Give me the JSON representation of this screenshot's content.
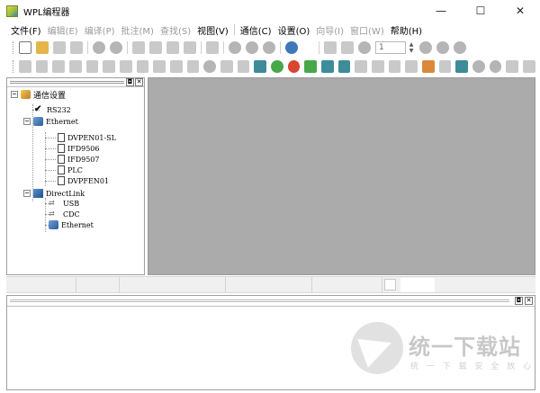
{
  "window": {
    "title": "WPL编程器",
    "minimize": "—",
    "maximize": "☐",
    "close": "✕"
  },
  "menu": [
    {
      "label": "文件(F)",
      "enabled": true
    },
    {
      "label": "编辑(E)",
      "enabled": false
    },
    {
      "label": "编译(P)",
      "enabled": false
    },
    {
      "label": "批注(M)",
      "enabled": false
    },
    {
      "label": "查找(S)",
      "enabled": false
    },
    {
      "label": "视图(V)",
      "enabled": true
    },
    {
      "label": "通信(C)",
      "enabled": true
    },
    {
      "label": "设置(O)",
      "enabled": true
    },
    {
      "label": "向导(I)",
      "enabled": false
    },
    {
      "label": "窗口(W)",
      "enabled": false
    },
    {
      "label": "帮助(H)",
      "enabled": true
    }
  ],
  "toolbar": {
    "step_value": "1"
  },
  "tree": {
    "root": "通信设置",
    "rs232": "RS232",
    "ethernet": "Ethernet",
    "ethernet_children": [
      "DVPEN01-SL",
      "IFD9506",
      "IFD9507",
      "PLC",
      "DVPFEN01"
    ],
    "directlink": "DirectLink",
    "directlink_children": [
      "USB",
      "CDC",
      "Ethernet"
    ]
  },
  "panel_buttons": {
    "pin": "◘",
    "close": "✕"
  },
  "watermark": {
    "brand": "统一下载站",
    "sub": "统 一 下 载  安 全 放 心"
  }
}
